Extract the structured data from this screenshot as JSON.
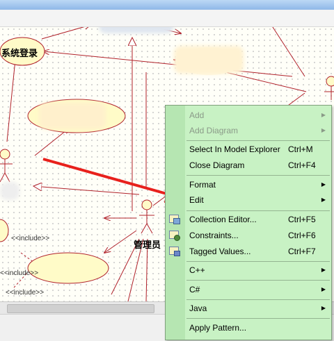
{
  "diagram": {
    "usecase_login": "系统登录",
    "actor_admin": "管理员",
    "include_labels": [
      "<<include>>",
      "<<include>>",
      "<<include>>"
    ]
  },
  "context_menu": {
    "add": "Add",
    "add_diagram": "Add Diagram",
    "select_in_model_explorer": "Select In Model Explorer",
    "select_shortcut": "Ctrl+M",
    "close_diagram": "Close Diagram",
    "close_shortcut": "Ctrl+F4",
    "format": "Format",
    "edit": "Edit",
    "collection_editor": "Collection Editor...",
    "collection_shortcut": "Ctrl+F5",
    "constraints": "Constraints...",
    "constraints_shortcut": "Ctrl+F6",
    "tagged_values": "Tagged Values...",
    "tagged_shortcut": "Ctrl+F7",
    "cpp": "C++",
    "csharp": "C#",
    "java": "Java",
    "apply_pattern": "Apply Pattern..."
  },
  "colors": {
    "menu_bg": "#c8f2c4",
    "usecase_fill": "#fffbc8",
    "line": "#b0202a",
    "highlight_arrow": "#e8201c"
  },
  "icons": [
    "collection-editor-icon",
    "constraints-icon",
    "tagged-values-icon",
    "submenu-arrow-icon"
  ]
}
